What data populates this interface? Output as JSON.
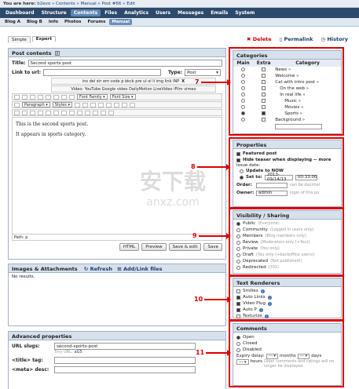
{
  "breadcrumb": {
    "prefix": "You are here:",
    "path": "b2evo » Contents » Manual » Post #66 » Edit"
  },
  "nav": [
    "Dashboard",
    "Structure",
    "Contents",
    "Files",
    "Analytics",
    "Users",
    "Messages",
    "Emails",
    "System"
  ],
  "nav_active": 2,
  "blogs": [
    "Blog A",
    "Blog B",
    "Info",
    "Photos",
    "Forums",
    "Manual"
  ],
  "blogs_active": 5,
  "tabs": [
    "Simple",
    "Expert"
  ],
  "actions": {
    "delete": "Delete",
    "permalink": "Permalink",
    "history": "History"
  },
  "post": {
    "header": "Post contents",
    "title_label": "Title:",
    "title_value": "Second sports post",
    "link_label": "Link to url:",
    "type_label": "Type:",
    "type_value": "Post",
    "toolbar1": "ins del str em code p bkck pre ul ol li img link INP",
    "toolbar1_x": "X",
    "toolbar_video": "Video:  YouTube  Google video  DailyMotion  LiveVideo  iFilm  vimeo",
    "font_family": "Font Family",
    "font_size": "Font Size",
    "paragraph": "Paragraph",
    "styles": "Styles",
    "body_line1": "This is the second sports post.",
    "body_line2": "It appears in sports category.",
    "path": "Path: p",
    "btn_html": "HTML",
    "btn_preview": "Preview",
    "btn_save_edit": "Save & edit",
    "btn_save": "Save"
  },
  "images": {
    "header": "Images & Attachments",
    "refresh": "Refresh",
    "add": "Add/Link files",
    "empty": "No results."
  },
  "advanced": {
    "header": "Advanced properties",
    "url_label": "URL slugs:",
    "url_value": "second-sports-post",
    "tiny_url": "Tiny URL:",
    "tiny_value": "aG5",
    "title_tag": "<title> tag:",
    "meta_desc": "<meta> desc:"
  },
  "categories": {
    "header": "Categories",
    "cols": [
      "Main",
      "Extra",
      "Category"
    ],
    "items": [
      {
        "name": "News",
        "indent": 0,
        "main": false,
        "extra": false
      },
      {
        "name": "Welcome",
        "indent": 0,
        "main": false,
        "extra": false
      },
      {
        "name": "Cat with intro post",
        "indent": 0,
        "main": false,
        "extra": false
      },
      {
        "name": "On the web",
        "indent": 1,
        "main": false,
        "extra": false
      },
      {
        "name": "In real life",
        "indent": 1,
        "main": false,
        "extra": false
      },
      {
        "name": "Music",
        "indent": 2,
        "main": false,
        "extra": false
      },
      {
        "name": "Movies",
        "indent": 2,
        "main": false,
        "extra": false
      },
      {
        "name": "Sports",
        "indent": 2,
        "main": true,
        "extra": true
      },
      {
        "name": "Background",
        "indent": 0,
        "main": false,
        "extra": false
      }
    ]
  },
  "properties": {
    "header": "Properties",
    "featured": "Featured post",
    "hide_teaser": "Hide teaser when displaying -- more",
    "issue_date": "Issue date:",
    "update_now": "Update to NOW",
    "set_to": "Set to:",
    "date_value": "2013-09/14/13",
    "time_value": "00:33:00",
    "order_label": "Order:",
    "order_hint": "can be decimal",
    "owner_label": "Owner:",
    "owner_value": "admin",
    "owner_hint": "login of this po"
  },
  "visibility": {
    "header": "Visibility / Sharing",
    "options": [
      {
        "label": "Public",
        "hint": "(Everyone)",
        "on": true
      },
      {
        "label": "Community",
        "hint": "(Logged in users only)",
        "on": false
      },
      {
        "label": "Members",
        "hint": "(Blog members only)",
        "on": false
      },
      {
        "label": "Review",
        "hint": "(Moderators only (+You))",
        "on": false
      },
      {
        "label": "Private",
        "hint": "(You only)",
        "on": false
      },
      {
        "label": "Draft",
        "hint": "(You only (+backoffice users))",
        "on": false
      },
      {
        "label": "Deprecated",
        "hint": "(Not published!)",
        "on": false
      },
      {
        "label": "Redirected",
        "hint": "(301)",
        "on": false
      }
    ]
  },
  "renderers": {
    "header": "Text Renderers",
    "items": [
      {
        "label": "Smilies",
        "on": false
      },
      {
        "label": "Auto Links",
        "on": true
      },
      {
        "label": "Video Plug",
        "on": true
      },
      {
        "label": "Auto P",
        "on": true
      },
      {
        "label": "Texturize",
        "on": false
      }
    ]
  },
  "comments": {
    "header": "Comments",
    "options": [
      {
        "label": "Open",
        "on": true
      },
      {
        "label": "Closed",
        "on": false
      },
      {
        "label": "Disabled",
        "on": false
      }
    ],
    "expiry_label": "Expiry delay:",
    "months": "months",
    "days": "days",
    "hours": "hours",
    "expiry_hint": "Older comments and ratings will no longer be displayed."
  },
  "annotations": [
    "7",
    "8",
    "9",
    "10",
    "11"
  ],
  "watermark": {
    "cn": "安下载",
    "en": "anxz.com"
  },
  "colors": {
    "accent": "#2d4a6b",
    "annotation": "#dd0000",
    "panel_head": "#d7e1ec"
  }
}
